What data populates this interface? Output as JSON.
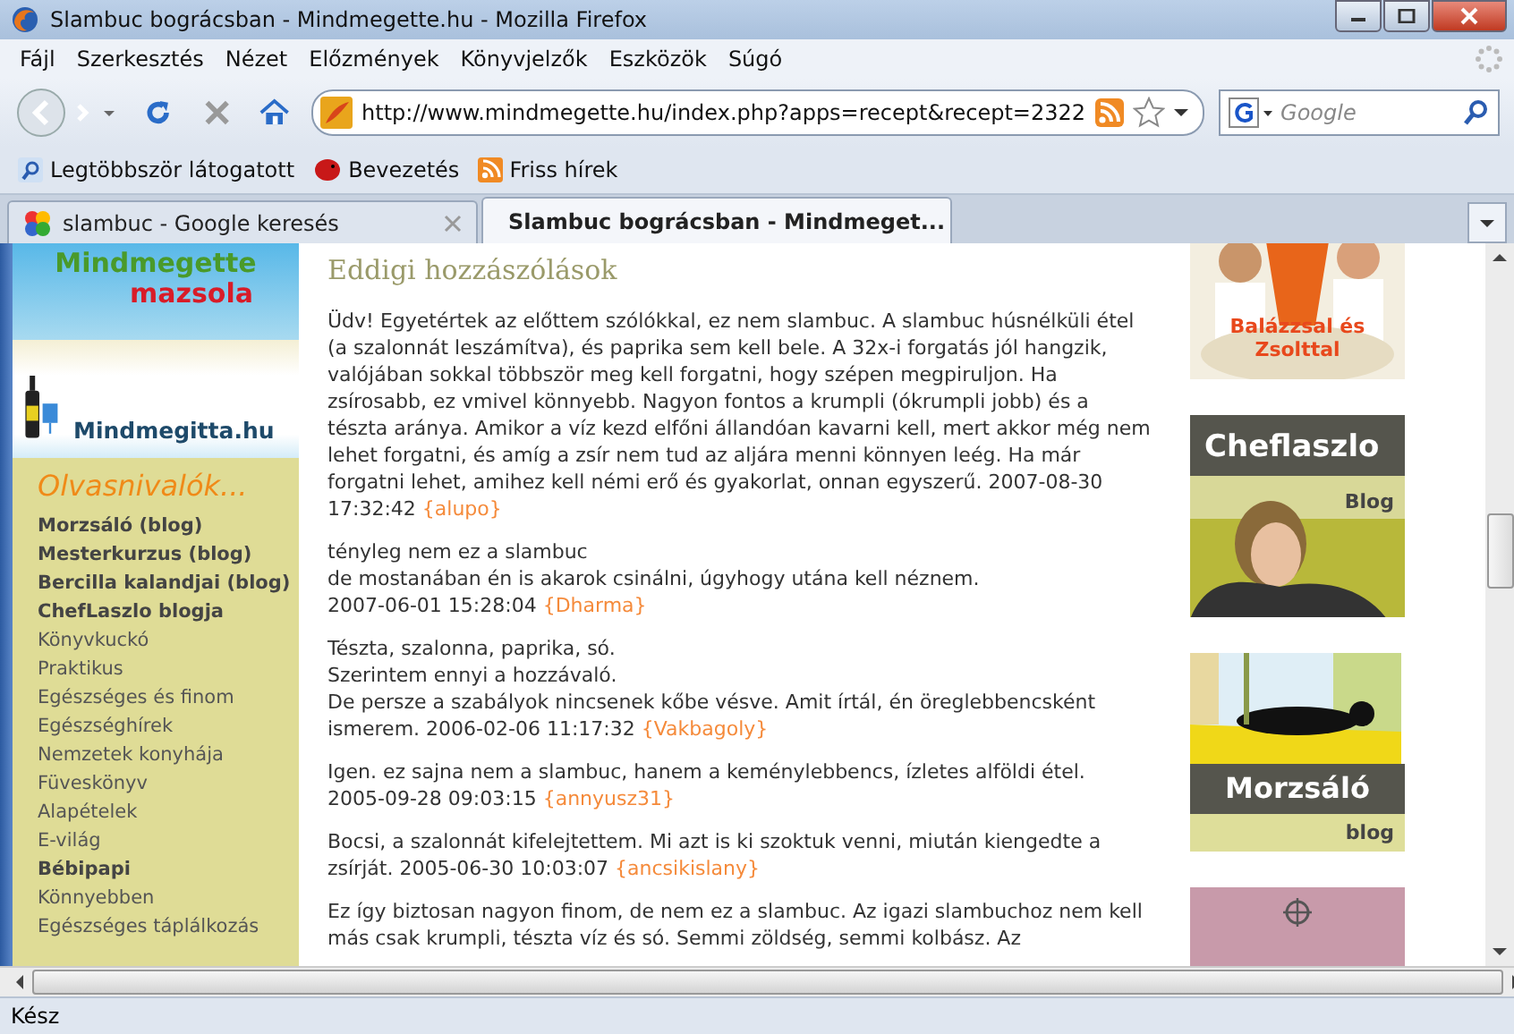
{
  "window": {
    "title": "Slambuc bográcsban - Mindmegette.hu - Mozilla Firefox"
  },
  "menu": [
    "Fájl",
    "Szerkesztés",
    "Nézet",
    "Előzmények",
    "Könyvjelzők",
    "Eszközök",
    "Súgó"
  ],
  "address": {
    "value": "http://www.mindmegette.hu/index.php?apps=recept&recept=2322"
  },
  "search": {
    "placeholder": "Google"
  },
  "bookmarks": [
    "Legtöbbször látogatott",
    "Bevezetés",
    "Friss hírek"
  ],
  "tabs": [
    {
      "label": "slambuc - Google keresés",
      "selected": false
    },
    {
      "label": "Slambuc bográcsban - Mindmeget...",
      "selected": true
    }
  ],
  "sidebar": {
    "logo_top": "Mindmegette",
    "logo_sub": "mazsola",
    "logo_drink": "Mindmegitta.hu",
    "heading": "Olvasnivalók...",
    "items": [
      {
        "label": "Morzsáló (blog)",
        "bold": true
      },
      {
        "label": "Mesterkurzus (blog)",
        "bold": true
      },
      {
        "label": "Bercilla kalandjai (blog)",
        "bold": true
      },
      {
        "label": "ChefLaszlo blogja",
        "bold": true
      },
      {
        "label": "Könyvkuckó",
        "bold": false
      },
      {
        "label": "Praktikus",
        "bold": false
      },
      {
        "label": "Egészséges és finom",
        "bold": false
      },
      {
        "label": "Egészséghírek",
        "bold": false
      },
      {
        "label": "Nemzetek konyhája",
        "bold": false
      },
      {
        "label": "Füveskönyv",
        "bold": false
      },
      {
        "label": "Alapételek",
        "bold": false
      },
      {
        "label": "E-világ",
        "bold": false
      },
      {
        "label": "Bébipapi",
        "bold": true
      },
      {
        "label": "Könnyebben",
        "bold": false
      },
      {
        "label": "Egészséges táplálkozás",
        "bold": false
      }
    ]
  },
  "comments_heading": "Eddigi hozzászólások",
  "comments": [
    {
      "text": "Üdv! Egyetértek az előttem szólókkal, ez nem slambuc. A slambuc húsnélküli étel (a szalonnát leszámítva), és paprika sem kell bele. A 32x-i forgatás jól hangzik, valójában sokkal többször meg kell forgatni, hogy szépen megpiruljon. Ha zsírosabb, ez vmivel könnyebb. Nagyon fontos a krumpli (ókrumpli jobb) és a tészta aránya. Amikor a víz kezd elfőni állandóan kavarni kell, mert akkor még nem lehet forgatni, és amíg a zsír nem tud az aljára menni könnyen leég. Ha már forgatni lehet, amihez kell némi erő és gyakorlat, onnan egyszerű.",
      "date": "2007-08-30 17:32:42",
      "author": "{alupo}"
    },
    {
      "text": "tényleg nem ez a slambuc\nde mostanában én is akarok csinálni, úgyhogy utána kell néznem.\n",
      "date": "2007-06-01 15:28:04",
      "author": "{Dharma}"
    },
    {
      "text": "Tészta, szalonna, paprika, só.\nSzerintem ennyi a hozzávaló.\nDe persze a szabályok nincsenek kőbe vésve. Amit írtál, én öreglebbencsként ismerem.",
      "date": "2006-02-06 11:17:32",
      "author": "{Vakbagoly}"
    },
    {
      "text": "Igen. ez sajna nem a slambuc, hanem a keménylebbencs, ízletes alföldi étel.\n",
      "date": "2005-09-28 09:03:15",
      "author": "{annyusz31}"
    },
    {
      "text": "Bocsi, a szalonnát kifelejtettem. Mi azt is ki szoktuk venni, miután kiengedte a zsírját.",
      "date": "2005-06-30 10:03:07",
      "author": "{ancsikislany}"
    },
    {
      "text": "Ez így biztosan nagyon finom, de nem ez a slambuc. Az igazi slambuchoz nem kell más csak krumpli, tészta víz és só. Semmi zöldség, semmi kolbász. Az"
    }
  ],
  "banners": [
    {
      "kind": "chefs",
      "title": "Balázzsal és Zsolttal"
    },
    {
      "kind": "blog",
      "title": "Cheflaszlo",
      "sub": "Blog"
    },
    {
      "kind": "cat",
      "title": "Morzsáló",
      "sub": "blog"
    },
    {
      "kind": "pink"
    }
  ],
  "status_bar": {
    "text": "Kész"
  }
}
